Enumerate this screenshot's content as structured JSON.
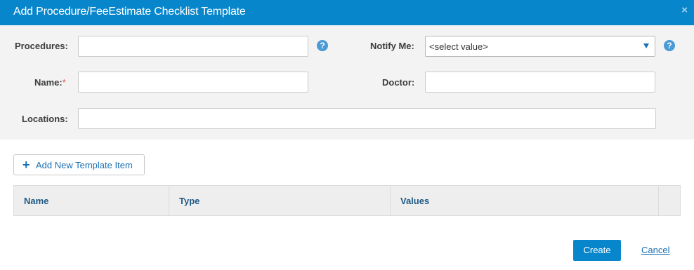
{
  "dialog": {
    "title": "Add Procedure/FeeEstimate Checklist Template",
    "close_icon": "×"
  },
  "form": {
    "procedures_label": "Procedures:",
    "procedures_value": "",
    "notify_label": "Notify Me:",
    "notify_value": "<select value>",
    "name_label": "Name:",
    "name_required": "*",
    "name_value": "",
    "doctor_label": "Doctor:",
    "doctor_value": "",
    "locations_label": "Locations:",
    "locations_value": "",
    "help_glyph": "?"
  },
  "toolbar": {
    "add_item_icon": "+",
    "add_item_label": "Add New Template Item"
  },
  "table": {
    "columns": [
      "Name",
      "Type",
      "Values",
      ""
    ]
  },
  "footer": {
    "create_label": "Create",
    "cancel_label": "Cancel"
  },
  "colors": {
    "accent": "#0786cc",
    "link": "#1a6fb3",
    "form_background": "#f3f3f3",
    "required": "#d9534f"
  }
}
